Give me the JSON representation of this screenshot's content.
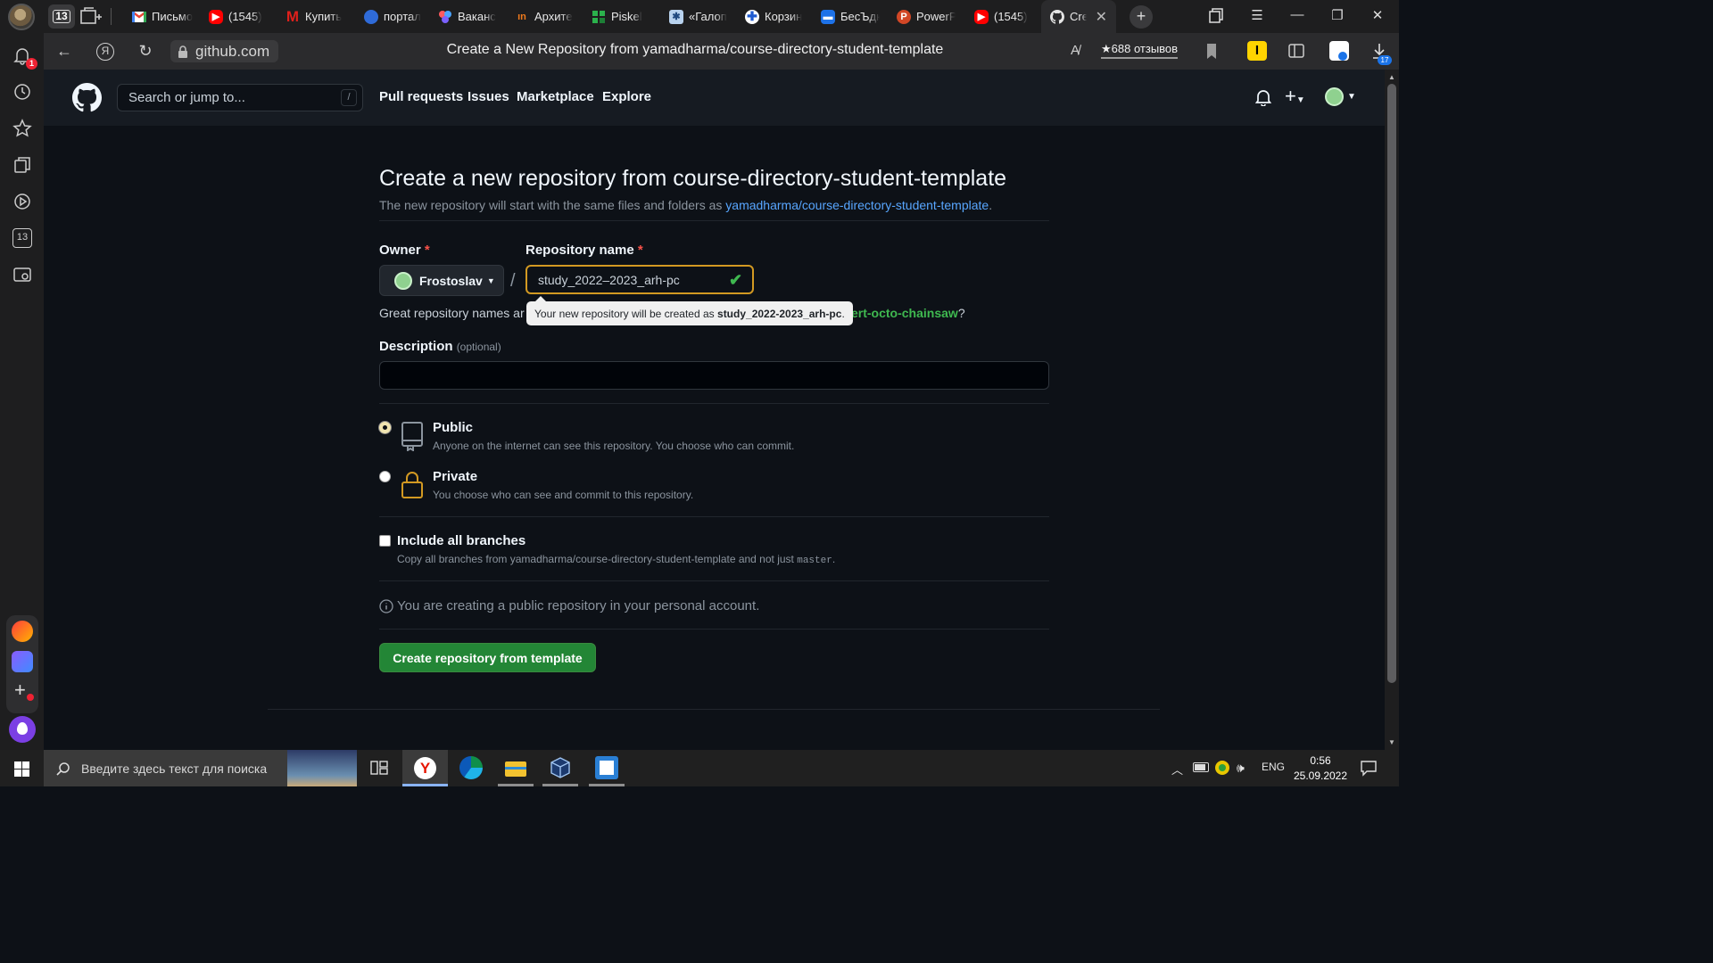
{
  "browser": {
    "tab_count": "13",
    "tabs": [
      {
        "label": "Письмо",
        "icon": "gmail-icon",
        "color": "#ea4335"
      },
      {
        "label": "(1545)",
        "icon": "youtube-icon",
        "color": "#ff0000"
      },
      {
        "label": "Купить",
        "icon": "m-logo-icon",
        "color": "#e0201b"
      },
      {
        "label": "портал",
        "icon": "portal-icon",
        "color": "#2f6bd8"
      },
      {
        "label": "Ваканс",
        "icon": "vacancy-icon",
        "color": "#6a5de8"
      },
      {
        "label": "Архите",
        "icon": "arch-icon",
        "color": "#f07a1c"
      },
      {
        "label": "Piskel",
        "icon": "piskel-icon",
        "color": "#2bb24c"
      },
      {
        "label": "«Галоп",
        "icon": "galop-icon",
        "color": "#7aa7d8"
      },
      {
        "label": "Корзин",
        "icon": "cross-icon",
        "color": "#1f5bd0"
      },
      {
        "label": "БесЪдк",
        "icon": "chat-icon",
        "color": "#1e72e8"
      },
      {
        "label": "PowerP",
        "icon": "powerpoint-icon",
        "color": "#d24726"
      },
      {
        "label": "(1545)",
        "icon": "youtube-icon",
        "color": "#ff0000"
      }
    ],
    "active_tab": {
      "label": "Crea",
      "icon": "github-icon"
    },
    "url": "github.com",
    "page_title": "Create a New Repository from yamadharma/course-directory-student-template",
    "reviews": "688 отзывов",
    "sidebar_badge": "1",
    "sidebar_tab_count": "13",
    "downloads_badge": "17"
  },
  "github": {
    "search_placeholder": "Search or jump to...",
    "search_shortcut": "/",
    "nav": [
      "Pull requests",
      "Issues",
      "Marketplace",
      "Explore"
    ],
    "plus_label": "+"
  },
  "form": {
    "heading": "Create a new repository from course-directory-student-template",
    "subtitle_prefix": "The new repository will start with the same files and folders as ",
    "subtitle_link": "yamadharma/course-directory-student-template",
    "subtitle_suffix": ".",
    "owner_label": "Owner",
    "owner_value": "Frostoslav",
    "repo_label": "Repository name",
    "required_mark": "*",
    "separator": "/",
    "repo_value": "study_2022–2023_arh-pc",
    "hint_prefix": "Great repository names ar",
    "hint_suggestion": "ert-octo-chainsaw",
    "hint_q": "?",
    "tooltip_prefix": "Your new repository will be created as ",
    "tooltip_name": "study_2022-2023_arh-pc",
    "tooltip_suffix": ".",
    "description_label": "Description",
    "description_optional": "(optional)",
    "description_value": "",
    "public_title": "Public",
    "public_desc": "Anyone on the internet can see this repository. You choose who can commit.",
    "private_title": "Private",
    "private_desc": "You choose who can see and commit to this repository.",
    "visibility": "public",
    "branches_title": "Include all branches",
    "branches_desc_prefix": "Copy all branches from yamadharma/course-directory-student-template and not just ",
    "branches_desc_code": "master",
    "branches_desc_suffix": ".",
    "info_text": "You are creating a public repository in your personal account.",
    "submit_label": "Create repository from template"
  },
  "taskbar": {
    "search_placeholder": "Введите здесь текст для поиска",
    "language": "ENG",
    "time": "0:56",
    "date": "25.09.2022"
  },
  "colors": {
    "accent_green": "#238636",
    "link_blue": "#58a6ff",
    "page_bg": "#0d1117",
    "required_red": "#f85149"
  }
}
